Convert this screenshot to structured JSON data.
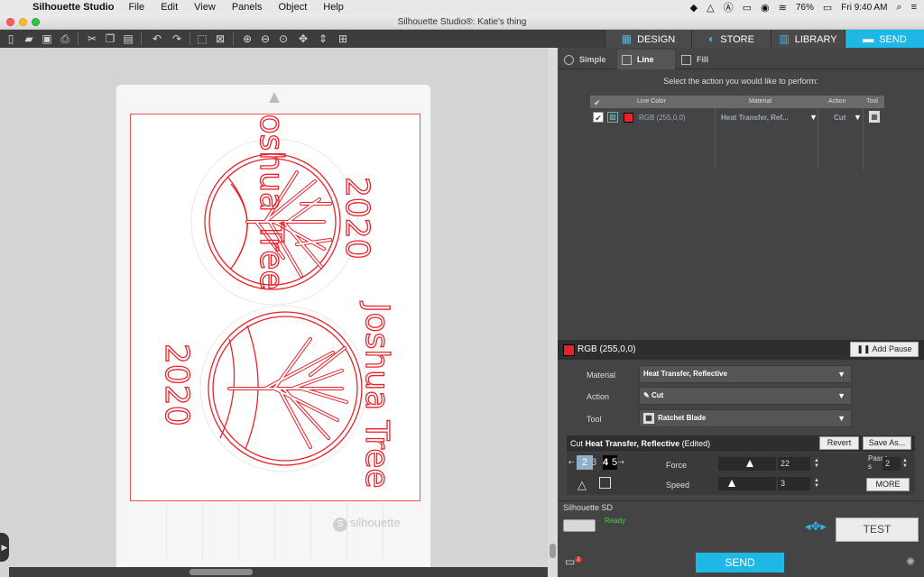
{
  "menubar": {
    "app_name": "Silhouette Studio",
    "menus": [
      "File",
      "Edit",
      "View",
      "Panels",
      "Object",
      "Help"
    ],
    "battery": "76%",
    "clock": "Fri 9:40 AM"
  },
  "window": {
    "title": "Silhouette Studio®: Katie's thing"
  },
  "main_tabs": {
    "design": "DESIGN",
    "store": "STORE",
    "library": "LIBRARY",
    "send": "SEND"
  },
  "design": {
    "text_top": "Joshua Tree",
    "text_bottom": "Joshua Tree",
    "year_top": "2020",
    "year_bottom": "2020",
    "watermark": "silhouette",
    "color": "#e8222a"
  },
  "panel": {
    "sub_tabs": [
      "Simple",
      "Line",
      "Fill"
    ],
    "instruction": "Select the action you would like to perform:",
    "table": {
      "headers": [
        "Line Color",
        "Material",
        "Action",
        "Tool"
      ],
      "row": {
        "color_label": "RGB (255,0,0)",
        "material": "Heat Transfer, Ref...",
        "action": "Cut"
      }
    },
    "selected_color": "RGB (255,0,0)",
    "add_pause": "Add Pause",
    "material_label": "Material",
    "material_value": "Heat Transfer, Reflective",
    "action_label": "Action",
    "action_value": "Cut",
    "tool_label": "Tool",
    "tool_value": "Ratchet Blade",
    "cut_title_prefix": "Cut",
    "cut_title_material": "Heat Transfer, Reflective",
    "cut_title_suffix": "(Edited)",
    "revert": "Revert",
    "save_as": "Save As...",
    "blade_digits": [
      "2",
      "3",
      "4",
      "5"
    ],
    "force_label": "Force",
    "force_value": "22",
    "force_level": 0.55,
    "speed_label": "Speed",
    "speed_value": "3",
    "speed_level": 0.2,
    "passes_label": "Passe\ns",
    "passes_value": "2",
    "more": "MORE",
    "device_name": "Silhouette SD",
    "device_status": "Ready",
    "test": "TEST",
    "send": "SEND",
    "notification_count": "2",
    "accent": "#1fb7e5"
  }
}
